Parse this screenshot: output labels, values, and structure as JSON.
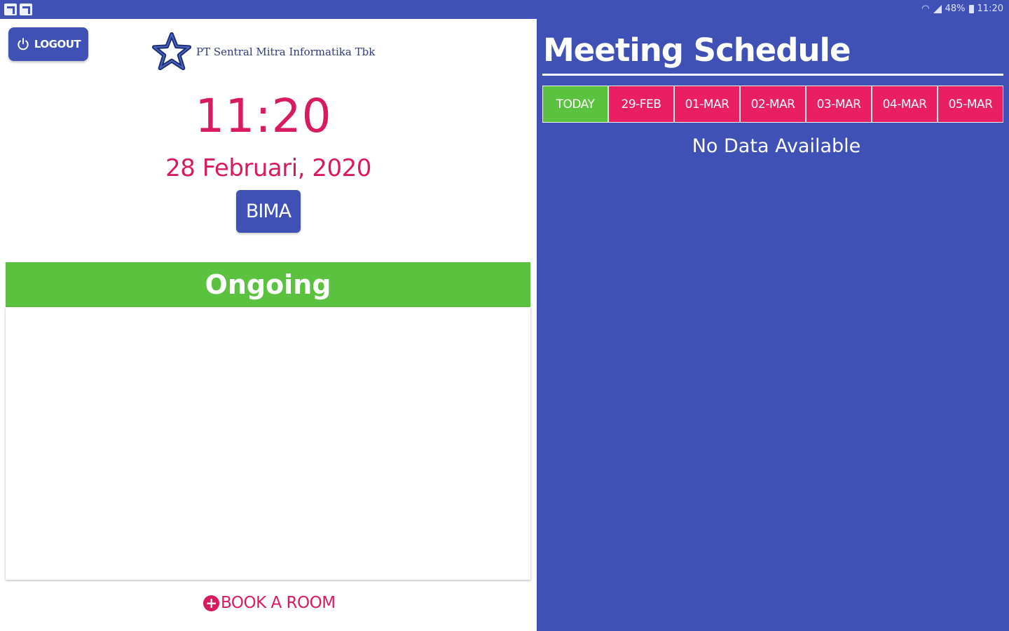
{
  "status_bar": {
    "battery": "48%",
    "time": "11:20"
  },
  "left": {
    "logout_label": "LOGOUT",
    "company_name": "PT Sentral Mitra Informatika Tbk",
    "clock": "11:20",
    "date": "28 Februari, 2020",
    "room_name": "BIMA",
    "status_title": "Ongoing",
    "book_label": "BOOK A ROOM"
  },
  "right": {
    "title": "Meeting Schedule",
    "tabs": [
      {
        "label": "TODAY",
        "active": true
      },
      {
        "label": "29-FEB",
        "active": false
      },
      {
        "label": "01-MAR",
        "active": false
      },
      {
        "label": "02-MAR",
        "active": false
      },
      {
        "label": "03-MAR",
        "active": false
      },
      {
        "label": "04-MAR",
        "active": false
      },
      {
        "label": "05-MAR",
        "active": false
      }
    ],
    "empty_message": "No Data Available"
  },
  "colors": {
    "primary": "#3f51b5",
    "accent": "#e91e63",
    "text_accent": "#d81b60",
    "success": "#5bc240"
  }
}
